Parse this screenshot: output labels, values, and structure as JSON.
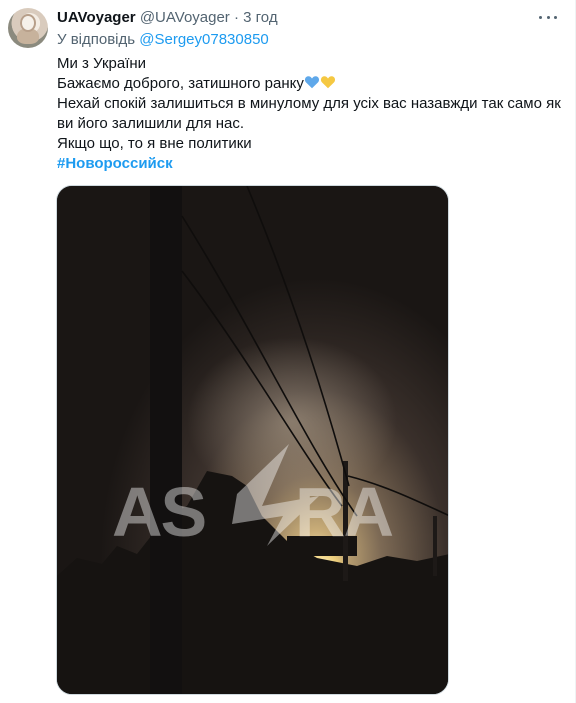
{
  "tweet": {
    "display_name": "UAVoyager",
    "handle": "@UAVoyager",
    "separator": "·",
    "time": "3 год",
    "reply_prefix": "У відповідь",
    "reply_mention": "@Sergey07830850",
    "lines": [
      "Ми з України",
      "Бажаємо доброго, затишного ранку",
      "Нехай спокій залишиться в минулому для усіх вас назавжди так само як",
      "ви його залишили для нас.",
      "Якщо що,  то я вне политики"
    ],
    "hashtag": "#Новороссийск",
    "heart_colors": {
      "blue": "#5fa8ea",
      "yellow": "#f5c842"
    },
    "icons": [
      "more-options-icon",
      "blue-heart-icon",
      "yellow-heart-icon"
    ]
  },
  "media": {
    "watermark": "ASTRA"
  },
  "colors": {
    "accent": "#1d9bf0",
    "muted": "#536471",
    "text": "#0f1419"
  }
}
